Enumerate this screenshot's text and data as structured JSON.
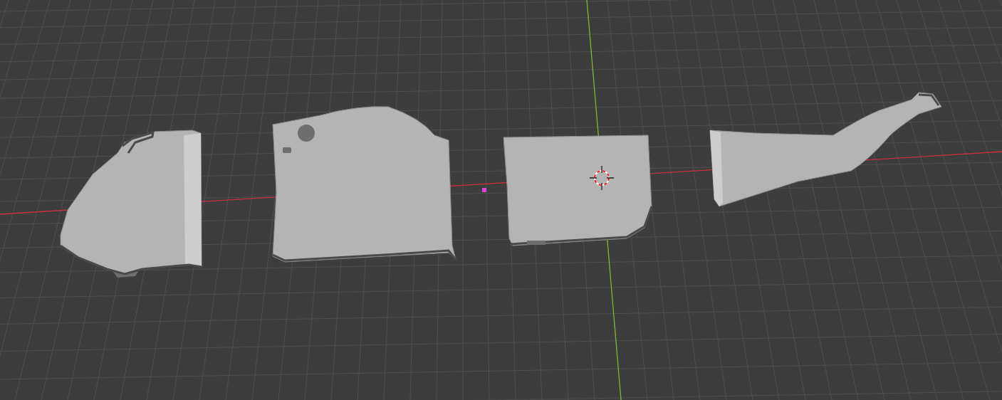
{
  "viewport": {
    "objects": [
      {
        "kind": "nose"
      },
      {
        "kind": "cabin"
      },
      {
        "kind": "midsection"
      },
      {
        "kind": "tail"
      }
    ]
  }
}
